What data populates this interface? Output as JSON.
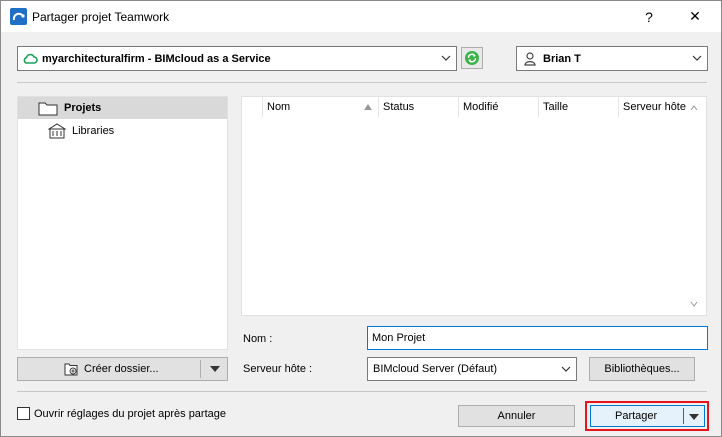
{
  "window": {
    "title": "Partager projet Teamwork",
    "help_label": "?",
    "close_label": "✕"
  },
  "server": {
    "selected": "myarchitecturalfirm - BIMcloud as a Service"
  },
  "user": {
    "selected": "Brian T"
  },
  "tree": {
    "items": [
      {
        "label": "Projets",
        "icon": "folder-icon",
        "selected": true
      },
      {
        "label": "Libraries",
        "icon": "library-icon",
        "selected": false
      }
    ]
  },
  "filelist": {
    "columns": [
      "Nom",
      "Status",
      "Modifié",
      "Taille",
      "Serveur hôte"
    ],
    "rows": []
  },
  "form": {
    "name_label": "Nom :",
    "name_value": "Mon Projet",
    "host_label": "Serveur hôte :",
    "host_value": "BIMcloud Server (Défaut)",
    "libraries_button": "Bibliothèques..."
  },
  "actions": {
    "create_folder": "Créer dossier...",
    "open_settings": "Ouvrir réglages du projet après partage",
    "cancel": "Annuler",
    "share": "Partager"
  },
  "colors": {
    "accent": "#0078d7",
    "highlight": "#e8141a",
    "cloud": "#1aa45a"
  }
}
